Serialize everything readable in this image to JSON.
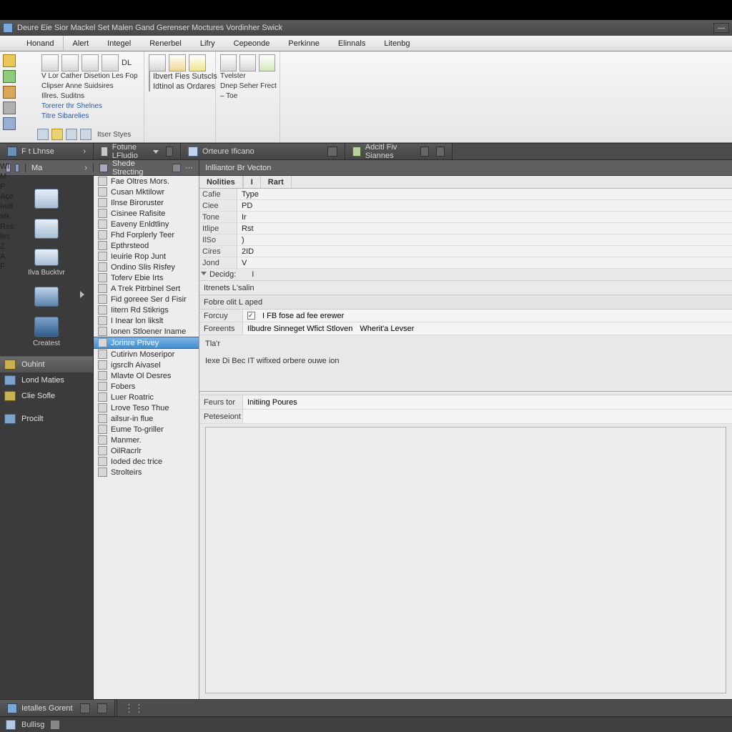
{
  "title": "Deure Eie Sior Mackel Set Malen Gand Gerenser Moctures Vordinher Swick",
  "menubar": [
    "Honand",
    "Alert",
    "Integel",
    "Renerbel",
    "Lifry",
    "Cepeonde",
    "Perkinne",
    "Elinnals",
    "Litenbg"
  ],
  "ribbon": {
    "group1_lines": [
      "V Lor Cather Disetion Les Fop",
      "Clipser Anne Suidsires",
      "Illres.        Suditns",
      "Torerer thr   Shelnes",
      "Titre Sibarelies"
    ],
    "group1_dl": "DL",
    "group2_lines": [
      "Ibvert Fies Sutscls",
      "Idtinol as Ordares"
    ],
    "group3_lines": [
      "Tvelster",
      "Dnep Seher Frect",
      "– Toe"
    ],
    "sub_label": "Itser Styes"
  },
  "wtabs": [
    {
      "label": "F   t   Lhnse"
    },
    {
      "label": "Fotune LFludio"
    },
    {
      "label": "Orteure Ificano"
    },
    {
      "label": "Adcitl Fiv Siannes"
    }
  ],
  "crumb": {
    "left_prefix": "M",
    "left": "Ma",
    "mid": "Shede Strecting",
    "right": "Inlliantor Br  Vecton"
  },
  "leftrag": [
    "Wi",
    "M",
    "P",
    "Aço",
    "Iwill",
    "stk",
    "Res",
    "les",
    " ",
    "Z",
    "A",
    "F"
  ],
  "sidebar_icons": [
    {
      "label": ""
    },
    {
      "label": ""
    },
    {
      "label": "Ilva Bucktvr"
    },
    {
      "label": "",
      "arrow": true
    },
    {
      "label": "Createst"
    }
  ],
  "sidebar_list": [
    {
      "label": "Ouhint",
      "icon": "a",
      "sel": true
    },
    {
      "label": "Lond Maties",
      "icon": "b"
    },
    {
      "label": "Clie Sofle",
      "icon": "a"
    },
    {
      "label": "Procilt",
      "icon": "b",
      "gap": true
    }
  ],
  "tree": [
    "Fae Oltres Mors.",
    "Cusan Mktilowr",
    "Ilnse Biroruster",
    "Cisinee Rafisite",
    "Eaveny Enldtliny",
    "Fhd Forplerly Teer",
    "Epthrsteod",
    "Ieuirie Rop Junt",
    "Ondino Slis Risfey",
    "Toferv Ebie Irts",
    "A Trek Pitrbinel Sert",
    "Fid goreee Ser d Fisir",
    "Iitern Rd Stikrigs",
    "I Inear lon likslt",
    "Ionen Stloener Iname",
    {
      "sel": true,
      "label": "Jorinre    Privey"
    },
    "Cutirivn Moseripor",
    "igsrclh Aivasel",
    "Mlavte Ol Desres",
    "Fobers",
    "Luer Roatric",
    "Lrove Teso Thue",
    "ailsur-in flue",
    "Eume To-griller",
    "Manmer.",
    "OilRacrlr",
    "Ioded dec trice",
    "Strolteirs"
  ],
  "props": {
    "head": [
      "Nolities",
      "I",
      "Rart"
    ],
    "rows": [
      {
        "k": "Cafie",
        "v": "Type"
      },
      {
        "k": "Ciee",
        "v": "PD"
      },
      {
        "k": "Tone",
        "v": "Ir"
      },
      {
        "k": "Itlipe",
        "v": "Rst"
      },
      {
        "k": "IlSo",
        "v": ")"
      },
      {
        "k": "Cires",
        "v": "2ID"
      },
      {
        "k": "Jond",
        "v": "V"
      }
    ],
    "desig": {
      "k": "Decidg:",
      "v": "I"
    },
    "section1": "Itrenets    L'salin",
    "section2": "Fobre olit L aped",
    "field1": {
      "k": "Forcuy",
      "v": "I FB fose ad fee erewer",
      "chk": true
    },
    "field2": {
      "k": "Foreents",
      "opts": [
        "Ilbudre Sinneget  Wfict  Stloven",
        "Wherit'a Levser"
      ]
    },
    "txt1": "Tla'r",
    "txt2": "Iexe Di Bec IT wifixed orbere ouwe ion",
    "field3": {
      "k": "Feurs tor",
      "v": "Initiing Poures"
    },
    "field4": {
      "k": "Peteseiont",
      "v": ""
    }
  },
  "status": {
    "a_tab": "Ietalles Gorent",
    "b_label": "Bullisg"
  }
}
